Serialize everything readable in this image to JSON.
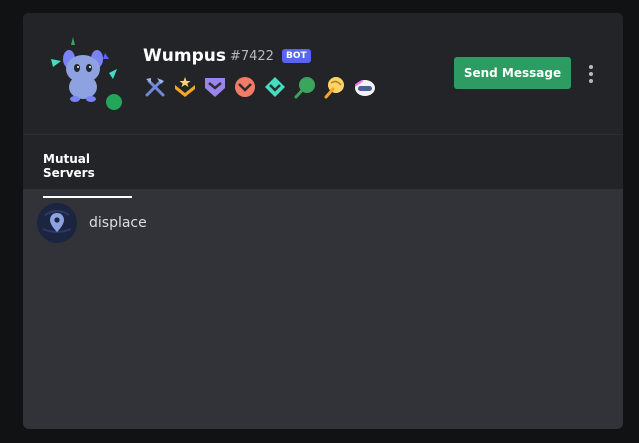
{
  "profile": {
    "username": "Wumpus",
    "discriminator": "#7422",
    "bot_tag": "BOT",
    "avatar_icon": "wumpus-avatar-icon",
    "status_color": "#23a55a",
    "badges": [
      "hammer-pickaxe-badge-icon",
      "gold-chevron-badge-icon",
      "purple-hypesquad-badge-icon",
      "red-hypesquad-badge-icon",
      "green-hypesquad-badge-icon",
      "green-leaf-badge-icon",
      "yellow-bug-hunter-badge-icon",
      "nitro-helmet-badge-icon"
    ]
  },
  "actions": {
    "send_message_label": "Send Message",
    "more_icon": "more-vertical-icon"
  },
  "tabs": [
    {
      "label": "Mutual Servers",
      "active": true
    }
  ],
  "mutual_servers": [
    {
      "name": "displace",
      "icon": "location-pin-icon"
    }
  ],
  "colors": {
    "accent_button": "#2d9b62",
    "bot_tag": "#5865f2",
    "header_bg": "#232428",
    "body_bg": "#313338"
  }
}
